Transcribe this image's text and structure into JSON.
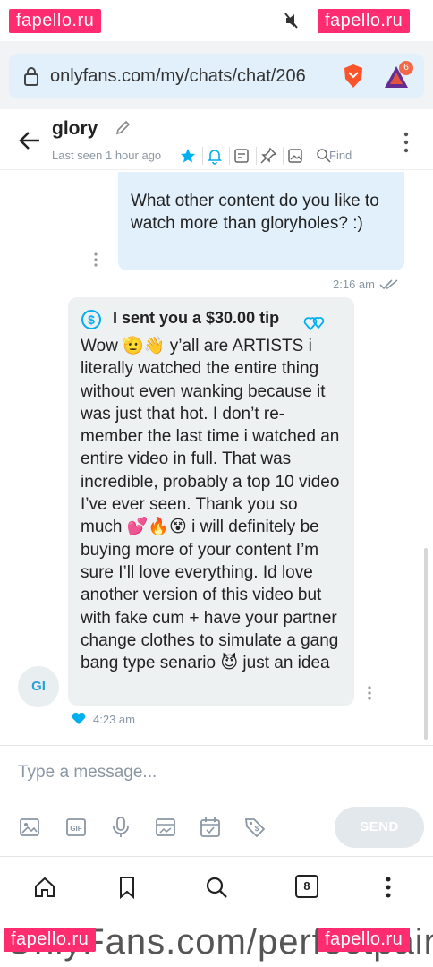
{
  "watermarks": {
    "label": "fapello.ru"
  },
  "browser": {
    "url": "onlyfans.com/my/chats/chat/206",
    "tab_badge": "6",
    "tabs_count": "8"
  },
  "chat": {
    "name": "glory",
    "last_seen": "Last seen 1 hour ago",
    "find_label": "Find"
  },
  "messages": [
    {
      "direction": "outgoing",
      "text": "What other content do you like to watch more than gloryholes? :)",
      "time": "2:16 am"
    },
    {
      "direction": "incoming",
      "tip": "I sent you a $30.00 tip",
      "text": "Wow 🫡👋 y’all are ARTISTS i literally watched the entire thing without even wanking because it was just that hot. I don’t re-member the last time i watched an entire video in full. That was incredible, probably a top 10 video I’ve ever seen. Thank you so much 💕🔥😵 i will definitely be buying more of your content I’m sure I’ll love everything. Id love another version of this video but with fake cum + have your partner change clothes to simulate a gang bang type senario 😈 just an idea",
      "time": "4:23 am",
      "avatar_initials": "GI"
    }
  ],
  "composer": {
    "placeholder": "Type a message...",
    "send_label": "SEND"
  },
  "bottom_url_fragment": "OnlyFans.com/perfectpair",
  "colors": {
    "accent": "#00aff0",
    "bubble_out": "#e1f0fb",
    "bubble_in": "#eef1f2",
    "watermark": "#ff2d6f"
  }
}
